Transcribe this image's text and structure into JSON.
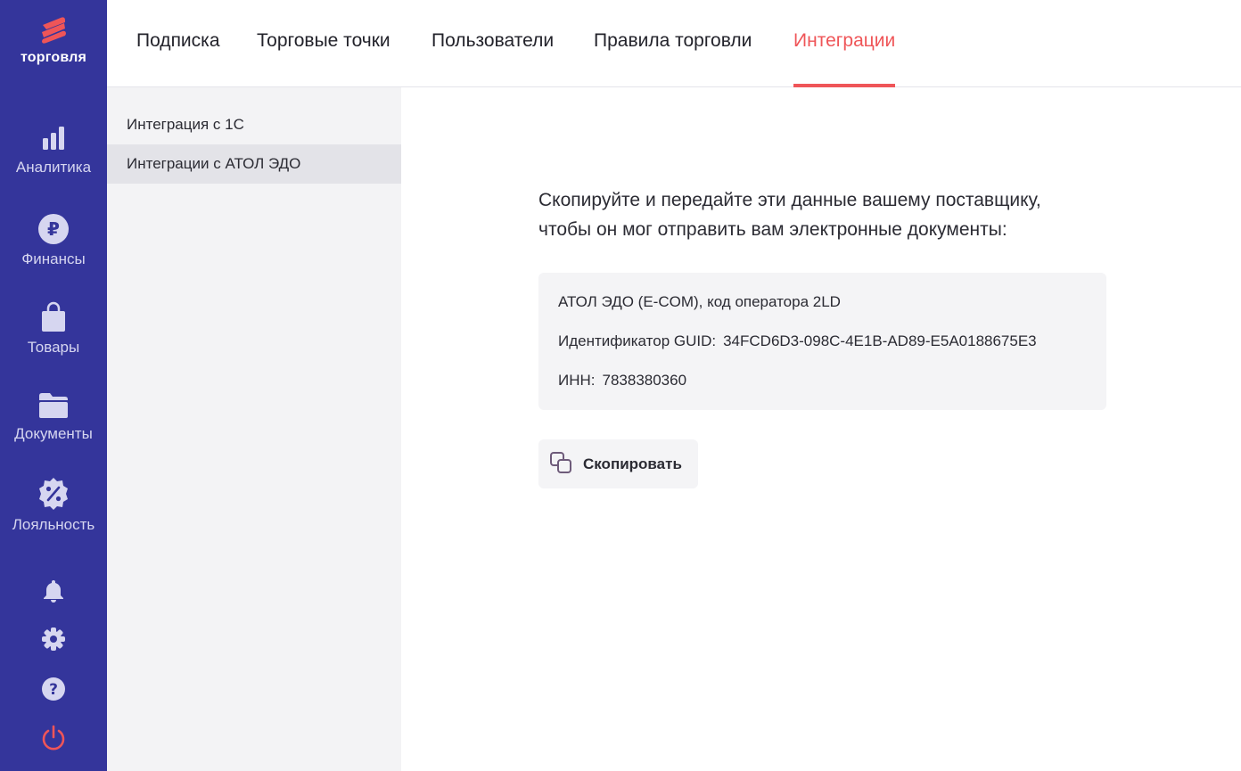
{
  "brand": {
    "name": "торговля",
    "logo": "torgovlya-logo-icon"
  },
  "rail": {
    "items": [
      {
        "label": "Аналитика",
        "icon": "bar-chart-icon"
      },
      {
        "label": "Финансы",
        "icon": "ruble-coin-icon"
      },
      {
        "label": "Товары",
        "icon": "shopping-bag-icon"
      },
      {
        "label": "Документы",
        "icon": "folder-icon"
      },
      {
        "label": "Лояльность",
        "icon": "discount-badge-icon"
      }
    ],
    "bottom": [
      {
        "icon": "bell-icon"
      },
      {
        "icon": "gear-icon"
      },
      {
        "icon": "help-icon"
      },
      {
        "icon": "power-icon"
      }
    ]
  },
  "tabs": [
    {
      "label": "Подписка"
    },
    {
      "label": "Торговые точки"
    },
    {
      "label": "Пользователи"
    },
    {
      "label": "Правила торговли"
    },
    {
      "label": "Интеграции",
      "active": true
    }
  ],
  "subnav": {
    "items": [
      {
        "label": "Интеграция с 1С"
      },
      {
        "label": "Интеграции с АТОЛ ЭДО",
        "active": true
      }
    ]
  },
  "main": {
    "lead_line1": "Скопируйте и передайте эти данные вашему поставщику,",
    "lead_line2": "чтобы он мог отправить вам электронные документы:",
    "operator": "АТОЛ ЭДО (E-COM), код оператора 2LD",
    "guid_label": "Идентификатор GUID:",
    "guid_value": "34FCD6D3-098C-4E1B-AD89-E5A0188675E3",
    "inn_label": "ИНН:",
    "inn_value": "7838380360",
    "copy_button": "Скопировать"
  },
  "colors": {
    "rail_bg": "#34359b",
    "accent": "#ef5558",
    "panel_bg": "#f3f3f5"
  }
}
